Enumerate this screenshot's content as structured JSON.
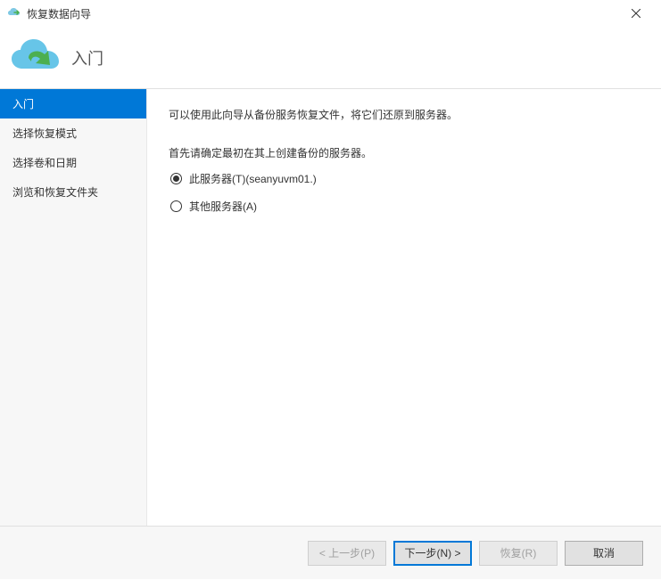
{
  "titlebar": {
    "title": "恢复数据向导"
  },
  "header": {
    "title": "入门"
  },
  "sidebar": {
    "items": [
      {
        "label": "入门",
        "active": true
      },
      {
        "label": "选择恢复模式",
        "active": false
      },
      {
        "label": "选择卷和日期",
        "active": false
      },
      {
        "label": "浏览和恢复文件夹",
        "active": false
      }
    ]
  },
  "content": {
    "intro": "可以使用此向导从备份服务恢复文件，将它们还原到服务器。",
    "prompt": "首先请确定最初在其上创建备份的服务器。",
    "options": [
      {
        "label": "此服务器(T)(seanyuvm01.)",
        "checked": true
      },
      {
        "label": "其他服务器(A)",
        "checked": false
      }
    ]
  },
  "footer": {
    "prev": "< 上一步(P)",
    "next": "下一步(N) >",
    "recover": "恢复(R)",
    "cancel": "取消"
  }
}
